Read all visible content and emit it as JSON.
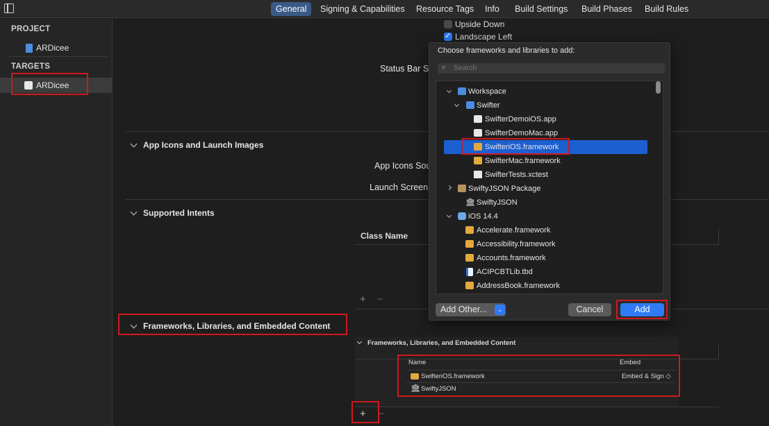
{
  "tabs": [
    "General",
    "Signing & Capabilities",
    "Resource Tags",
    "Info",
    "Build Settings",
    "Build Phases",
    "Build Rules"
  ],
  "sidebar": {
    "project_header": "PROJECT",
    "project_item": "ARDicee",
    "targets_header": "TARGETS",
    "target_item": "ARDicee"
  },
  "orientation": {
    "upside_down": "Upside Down",
    "upside_down_checked": false,
    "landscape_left": "Landscape Left",
    "landscape_left_checked": true
  },
  "labels": {
    "status_bar_style": "Status Bar Sty",
    "app_icons_source": "App Icons Sour",
    "launch_screen": "Launch Screen F",
    "class_name": "Class Name"
  },
  "sections": {
    "app_icons": "App Icons and Launch Images",
    "supported_intents": "Supported Intents",
    "frameworks": "Frameworks, Libraries, and Embedded Content"
  },
  "dialog": {
    "prompt": "Choose frameworks and libraries to add:",
    "search_placeholder": "Search",
    "tree": [
      {
        "label": "Workspace",
        "icon": "workspace-icon"
      },
      {
        "label": "Swifter",
        "icon": "project-icon"
      },
      {
        "label": "SwifterDemoiOS.app",
        "icon": "app-icon"
      },
      {
        "label": "SwifterDemoMac.app",
        "icon": "app-icon"
      },
      {
        "label": "SwifteriOS.framework",
        "icon": "framework-icon",
        "selected": true
      },
      {
        "label": "SwifterMac.framework",
        "icon": "framework-icon"
      },
      {
        "label": "SwifterTests.xctest",
        "icon": "test-bundle-icon"
      },
      {
        "label": "SwiftyJSON Package",
        "icon": "package-icon"
      },
      {
        "label": "SwiftyJSON",
        "icon": "library-icon"
      },
      {
        "label": "iOS 14.4",
        "icon": "sdk-icon"
      },
      {
        "label": "Accelerate.framework",
        "icon": "framework-icon"
      },
      {
        "label": "Accessibility.framework",
        "icon": "framework-icon"
      },
      {
        "label": "Accounts.framework",
        "icon": "framework-icon"
      },
      {
        "label": "ACIPCBTLib.tbd",
        "icon": "tbd-icon"
      },
      {
        "label": "AddressBook.framework",
        "icon": "framework-icon"
      }
    ],
    "add_other": "Add Other...",
    "cancel": "Cancel",
    "add": "Add"
  },
  "embedded": {
    "title": "Frameworks, Libraries, and Embedded Content",
    "col_name": "Name",
    "col_embed": "Embed",
    "rows": [
      {
        "name": "SwifteriOS.framework",
        "embed": "Embed & Sign ◇"
      },
      {
        "name": "SwiftyJSON",
        "embed": ""
      }
    ]
  },
  "controls": {
    "plus": "+",
    "minus": "−"
  },
  "colors": {
    "accent": "#2f7bf5",
    "annotation_red": "#d0191f",
    "selection": "#1c5fd0"
  }
}
